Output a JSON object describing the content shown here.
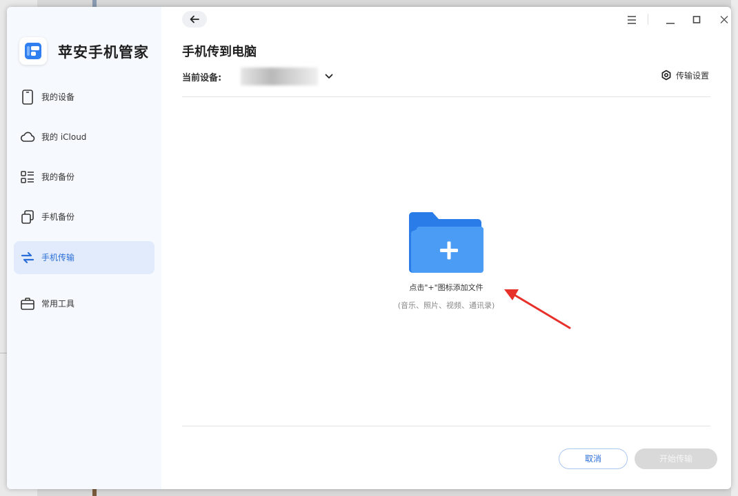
{
  "app": {
    "title": "苹安手机管家"
  },
  "sidebar": {
    "items": [
      {
        "label": "我的设备",
        "icon": "phone-icon",
        "active": false
      },
      {
        "label": "我的 iCloud",
        "icon": "cloud-icon",
        "active": false
      },
      {
        "label": "我的备份",
        "icon": "list-icon",
        "active": false
      },
      {
        "label": "手机备份",
        "icon": "copy-icon",
        "active": false
      },
      {
        "label": "手机传输",
        "icon": "transfer-icon",
        "active": true
      },
      {
        "label": "常用工具",
        "icon": "toolbox-icon",
        "active": false
      }
    ]
  },
  "header": {
    "page_title": "手机传到电脑",
    "device_label": "当前设备:",
    "transfer_settings_label": "传输设置"
  },
  "drop_area": {
    "hint_main": "点击\"+\"图标添加文件",
    "hint_sub": "(音乐、照片、视频、通讯录)"
  },
  "footer": {
    "cancel_label": "取消",
    "start_label": "开始传输"
  },
  "colors": {
    "accent": "#2b6ed9",
    "folder_front": "#4b9cf5",
    "folder_back": "#2a7ce8",
    "annotation_arrow": "#e8302a",
    "sidebar_active_bg": "#e1ebfb"
  }
}
